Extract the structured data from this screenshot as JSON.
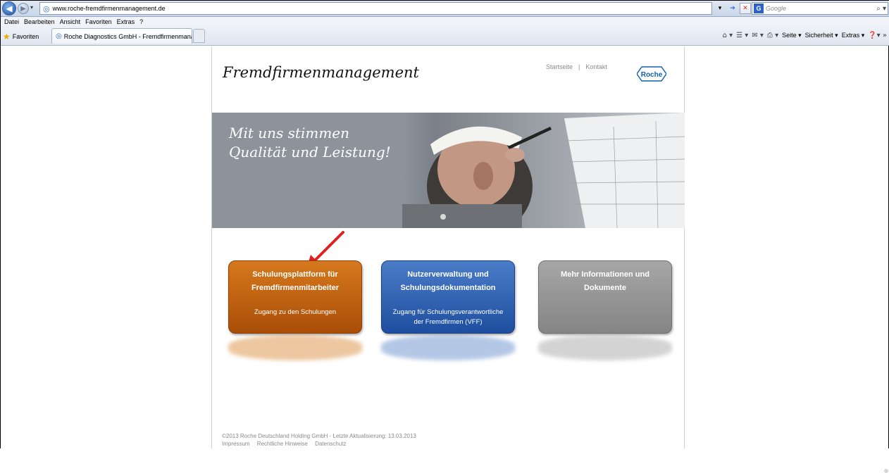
{
  "browser": {
    "url": "www.roche-fremdfirmenmanagement.de",
    "search_placeholder": "Google",
    "menu": [
      "Datei",
      "Bearbeiten",
      "Ansicht",
      "Favoriten",
      "Extras",
      "?"
    ],
    "favorites_label": "Favoriten",
    "tab_title": "Roche Diagnostics GmbH - Fremdfirmenmanage...",
    "cmd": {
      "page": "Seite ▾",
      "security": "Sicherheit ▾",
      "extras": "Extras ▾"
    }
  },
  "site": {
    "title": "Fremdfirmenmanagement",
    "nav": {
      "home": "Startseite",
      "sep": "|",
      "contact": "Kontakt"
    },
    "logo_text": "Roche",
    "hero_line1": "Mit uns stimmen",
    "hero_line2": "Qualität und Leistung!",
    "tiles": [
      {
        "title1": "Schulungsplattform für",
        "title2": "Fremdfirmenmitarbeiter",
        "sub1": "Zugang zu den Schulungen",
        "sub2": ""
      },
      {
        "title1": "Nutzerverwaltung und",
        "title2": "Schulungsdokumentation",
        "sub1": "Zugang für Schulungsverantwortliche",
        "sub2": "der Fremdfirmen (VFF)"
      },
      {
        "title1": "Mehr Informationen und",
        "title2": "Dokumente",
        "sub1": "",
        "sub2": ""
      }
    ],
    "footer_line": "©2013 Roche Deutschland Holding GmbH  -  Letzte Aktualisierung: 13.03.2013",
    "footer_links": [
      "Impressum",
      "Rechtliche Hinweise",
      "Datenschutz"
    ]
  },
  "colors": {
    "tile1": "#c0620f",
    "tile2": "#2f62b3",
    "tile3": "#959595",
    "arrow": "#e02020",
    "roche_blue": "#1060b0"
  }
}
